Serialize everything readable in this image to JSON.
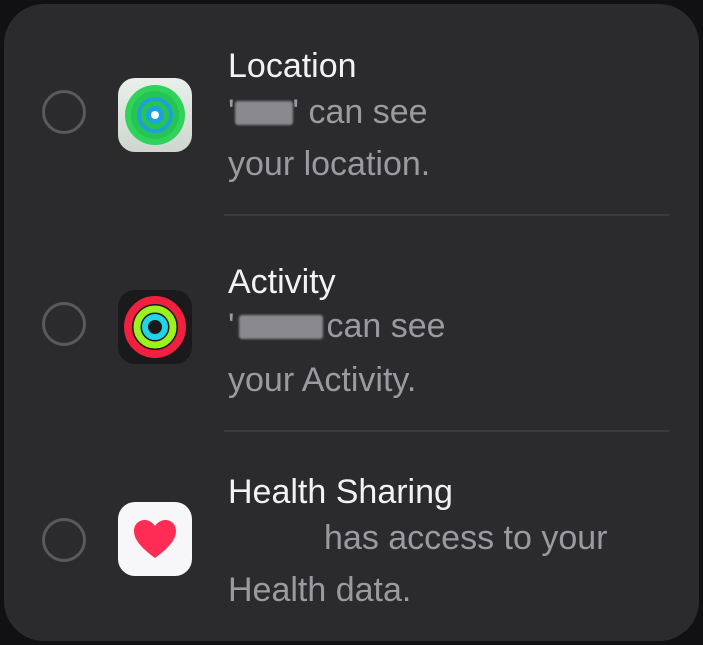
{
  "colors": {
    "card_background": "#2b2b2e",
    "title_text": "#f2f2f4",
    "description_text": "#9a9a9f",
    "radio_border": "#5a5a5e"
  },
  "items": [
    {
      "icon": "find-my-icon",
      "title": "Location",
      "description_line1_prefix": "'",
      "description_line1_suffix": "' can see",
      "description_line2": "your location."
    },
    {
      "icon": "activity-rings-icon",
      "title": "Activity",
      "description_line1_prefix": "'",
      "description_line1_suffix": "can see",
      "description_line2": "your Activity."
    },
    {
      "icon": "health-heart-icon",
      "title": "Health Sharing",
      "description_line1_prefix": "",
      "description_line1_suffix": "has access to your",
      "description_line2": "Health data."
    }
  ]
}
